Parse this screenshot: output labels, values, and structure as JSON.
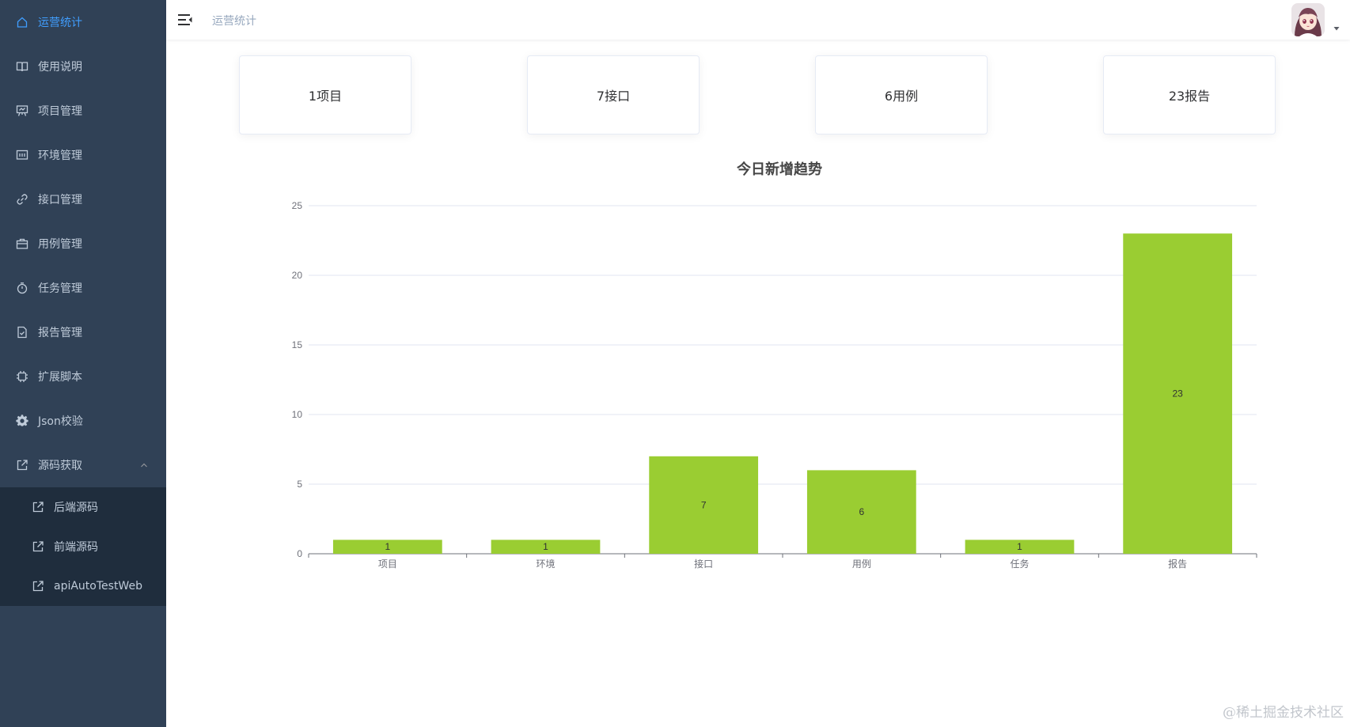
{
  "sidebar": {
    "items": [
      {
        "label": "运营统计",
        "icon": "home-icon",
        "active": true
      },
      {
        "label": "使用说明",
        "icon": "book-icon"
      },
      {
        "label": "项目管理",
        "icon": "presentation-icon"
      },
      {
        "label": "环境管理",
        "icon": "monitor-icon"
      },
      {
        "label": "接口管理",
        "icon": "link-icon"
      },
      {
        "label": "用例管理",
        "icon": "briefcase-icon"
      },
      {
        "label": "任务管理",
        "icon": "timer-icon"
      },
      {
        "label": "报告管理",
        "icon": "document-check-icon"
      },
      {
        "label": "扩展脚本",
        "icon": "chip-icon"
      },
      {
        "label": "Json校验",
        "icon": "gear-icon"
      },
      {
        "label": "源码获取",
        "icon": "external-link-icon",
        "expanded": true
      }
    ],
    "submenu": [
      {
        "label": "后端源码",
        "icon": "external-link-icon"
      },
      {
        "label": "前端源码",
        "icon": "external-link-icon"
      },
      {
        "label": "apiAutoTestWeb",
        "icon": "external-link-icon"
      }
    ],
    "colors": {
      "bg": "#304156",
      "submenu_bg": "#1f2d3d",
      "text": "#bfcbd9",
      "active": "#409eff"
    }
  },
  "header": {
    "breadcrumb": "运营统计",
    "hamburger_icon": "menu-fold-icon",
    "avatar_icon": "user-avatar"
  },
  "cards": [
    {
      "label": "1项目"
    },
    {
      "label": "7接口"
    },
    {
      "label": "6用例"
    },
    {
      "label": "23报告"
    }
  ],
  "chart_data": {
    "type": "bar",
    "title": "今日新增趋势",
    "categories": [
      "项目",
      "环境",
      "接口",
      "用例",
      "任务",
      "报告"
    ],
    "values": [
      1,
      1,
      7,
      6,
      1,
      23
    ],
    "ylim": [
      0,
      25
    ],
    "yticks": [
      0,
      5,
      10,
      15,
      20,
      25
    ],
    "color": "#9acd32",
    "data_labels": true,
    "grid": true
  },
  "watermark": "@稀土掘金技术社区"
}
